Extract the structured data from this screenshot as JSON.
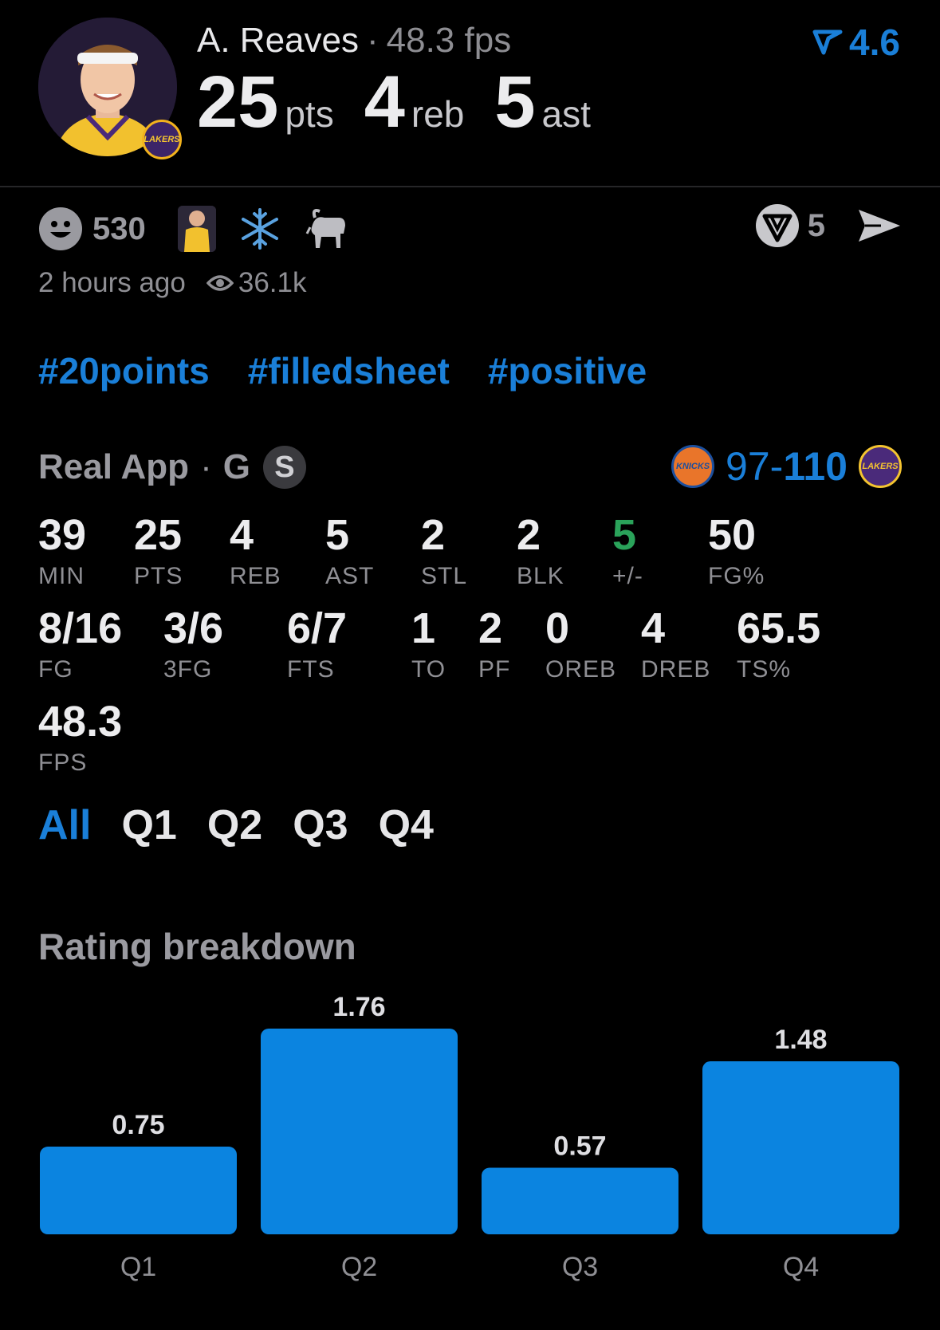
{
  "header": {
    "player_name": "A. Reaves",
    "fps_text": "48.3 fps",
    "rating": "4.6",
    "headline": [
      {
        "value": "25",
        "unit": "pts"
      },
      {
        "value": "4",
        "unit": "reb"
      },
      {
        "value": "5",
        "unit": "ast"
      }
    ]
  },
  "reactions": {
    "smile_count": "530",
    "time_ago": "2 hours ago",
    "views": "36.1k",
    "comment_count": "5"
  },
  "hashtags": [
    "#20points",
    "#filledsheet",
    "#positive"
  ],
  "game": {
    "source": "Real App",
    "position": "G",
    "badge": "S",
    "score_home": "97",
    "score_sep": "-",
    "score_away": "110",
    "home_team_logo": "KNICKS",
    "away_team_logo": "LAKERS"
  },
  "stats": {
    "row1": [
      {
        "value": "39",
        "label": "MIN"
      },
      {
        "value": "25",
        "label": "PTS"
      },
      {
        "value": "4",
        "label": "REB"
      },
      {
        "value": "5",
        "label": "AST"
      },
      {
        "value": "2",
        "label": "STL"
      },
      {
        "value": "2",
        "label": "BLK"
      },
      {
        "value": "5",
        "label": "+/-"
      },
      {
        "value": "50",
        "label": "FG%"
      }
    ],
    "row2": [
      {
        "value": "8/16",
        "label": "FG"
      },
      {
        "value": "3/6",
        "label": "3FG"
      },
      {
        "value": "6/7",
        "label": "FTS"
      },
      {
        "value": "1",
        "label": "TO"
      },
      {
        "value": "2",
        "label": "PF"
      },
      {
        "value": "0",
        "label": "OREB"
      },
      {
        "value": "4",
        "label": "DREB"
      },
      {
        "value": "65.5",
        "label": "TS%"
      }
    ],
    "row3": [
      {
        "value": "48.3",
        "label": "FPS"
      }
    ],
    "plus_minus_color": "#2aa35a"
  },
  "quarter_tabs": [
    "All",
    "Q1",
    "Q2",
    "Q3",
    "Q4"
  ],
  "active_tab": "All",
  "chart_title": "Rating breakdown",
  "colors": {
    "accent": "#1a7fd8",
    "background": "#000000",
    "positive": "#2aa35a"
  },
  "chart_data": {
    "type": "bar",
    "title": "Rating breakdown",
    "categories": [
      "Q1",
      "Q2",
      "Q3",
      "Q4"
    ],
    "values": [
      0.75,
      1.76,
      0.57,
      1.48
    ],
    "value_labels": [
      "0.75",
      "1.76",
      "0.57",
      "1.48"
    ],
    "xlabel": "",
    "ylabel": "",
    "ylim": [
      0,
      1.76
    ],
    "grid": false,
    "bar_color": "#0b84e0"
  }
}
